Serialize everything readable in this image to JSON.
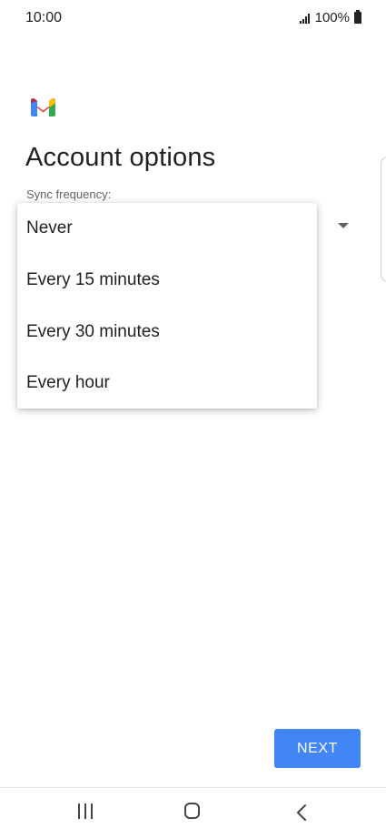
{
  "status_bar": {
    "time": "10:00",
    "battery": "100%"
  },
  "header": {
    "title": "Account options"
  },
  "sync_field": {
    "label": "Sync frequency:"
  },
  "menu": {
    "items": [
      {
        "label": "Never"
      },
      {
        "label": "Every 15 minutes"
      },
      {
        "label": "Every 30 minutes"
      },
      {
        "label": "Every hour"
      }
    ]
  },
  "footer": {
    "next_label": "NEXT"
  },
  "nav": {
    "icons": [
      "recents-icon",
      "home-icon",
      "back-icon"
    ]
  },
  "colors": {
    "accent": "#4285f4",
    "gmail_red": "#ea4335",
    "gmail_blue": "#4285f4",
    "gmail_green": "#34a853",
    "gmail_yellow": "#fbbc04"
  }
}
